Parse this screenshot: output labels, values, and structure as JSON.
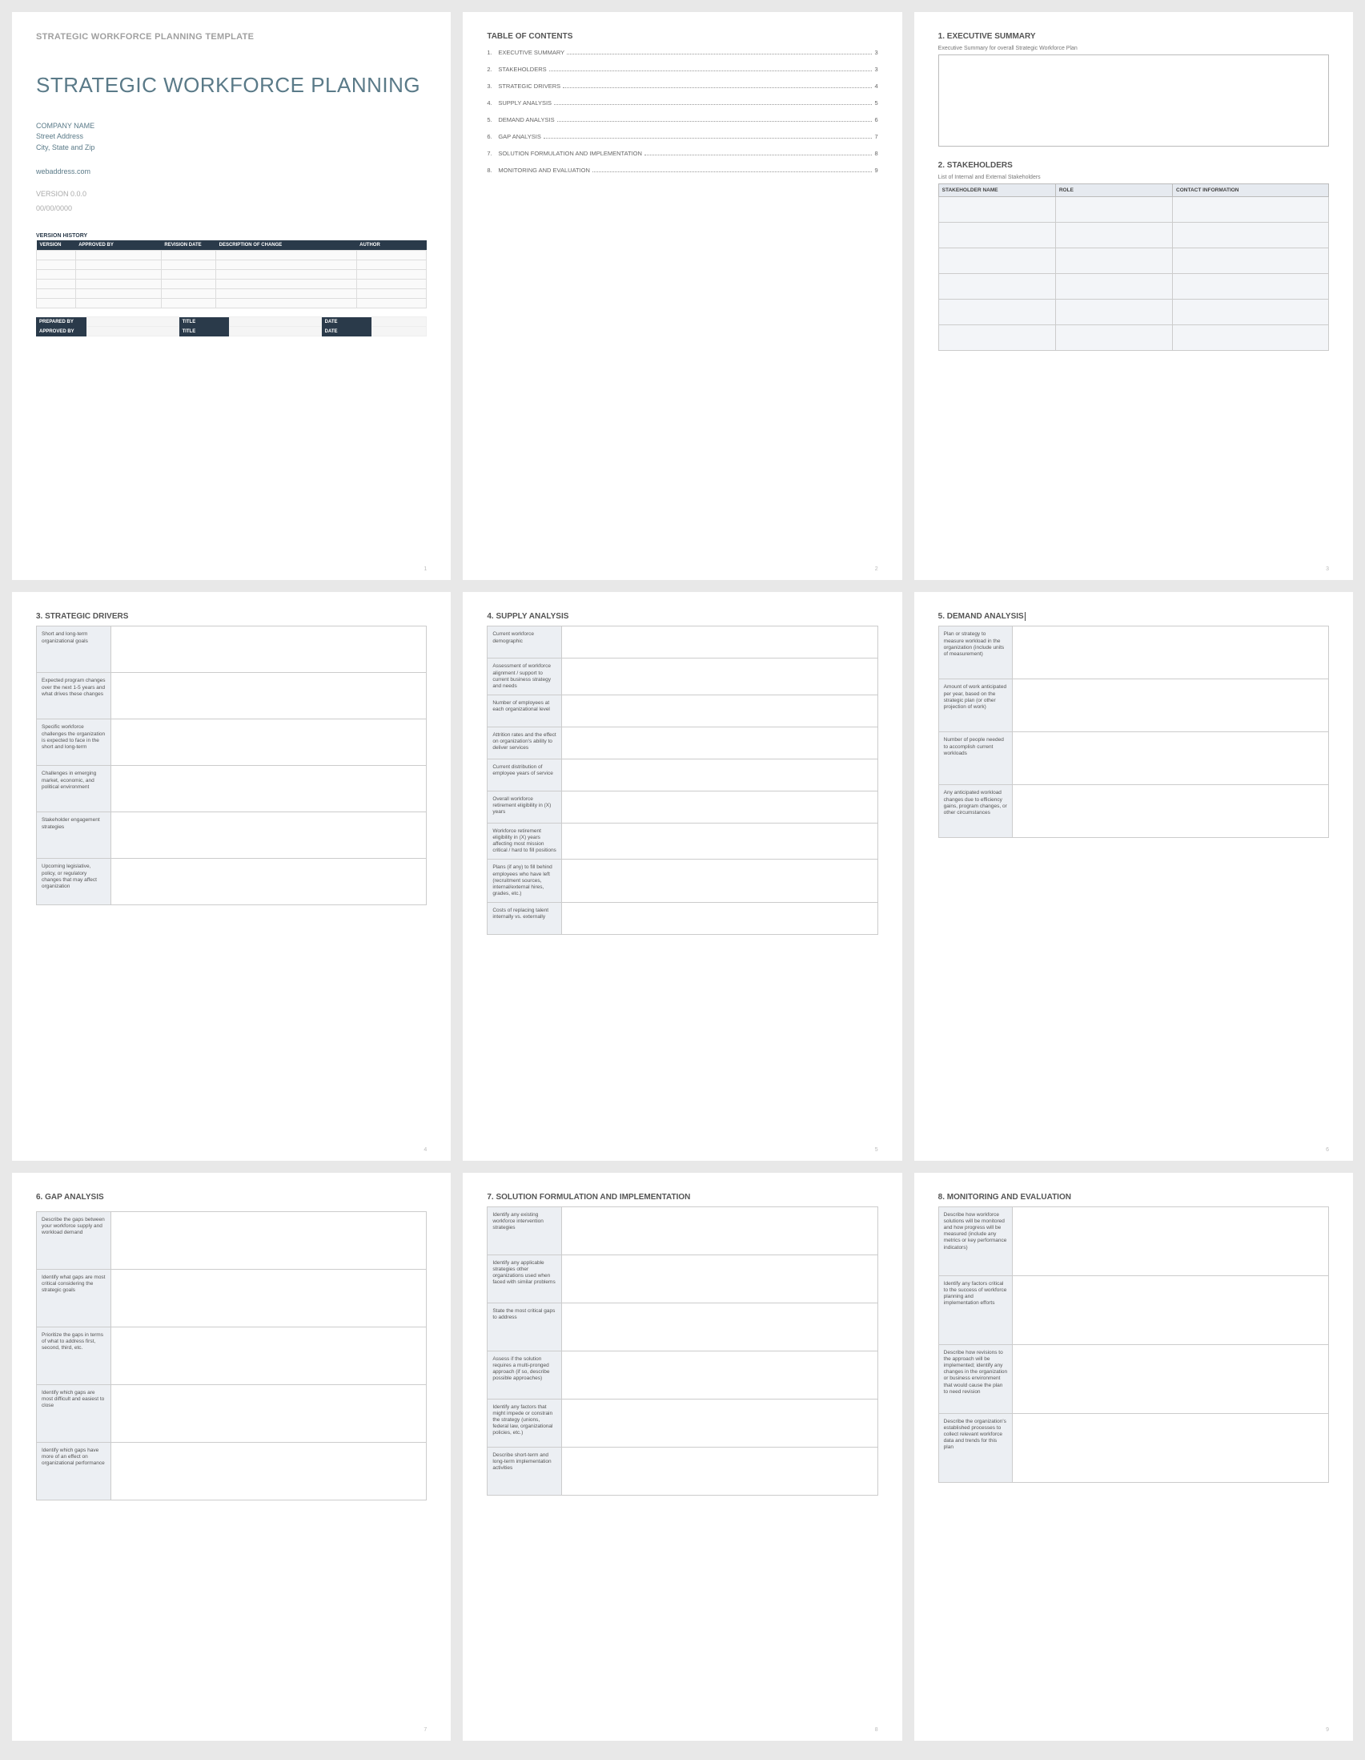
{
  "doc_header": "STRATEGIC WORKFORCE PLANNING TEMPLATE",
  "doc_title": "STRATEGIC WORKFORCE PLANNING",
  "company": {
    "name": "COMPANY NAME",
    "street": "Street Address",
    "city": "City, State and Zip",
    "web": "webaddress.com"
  },
  "version_line": "VERSION 0.0.0",
  "date_line": "00/00/0000",
  "version_history_title": "VERSION HISTORY",
  "vh_headers": [
    "VERSION",
    "APPROVED BY",
    "REVISION DATE",
    "DESCRIPTION OF CHANGE",
    "AUTHOR"
  ],
  "meta_labels": {
    "prepared": "PREPARED BY",
    "approved": "APPROVED BY",
    "title": "TITLE",
    "date": "DATE"
  },
  "toc_title": "TABLE OF CONTENTS",
  "toc": [
    {
      "n": "1.",
      "t": "EXECUTIVE SUMMARY",
      "p": "3"
    },
    {
      "n": "2.",
      "t": "STAKEHOLDERS",
      "p": "3"
    },
    {
      "n": "3.",
      "t": "STRATEGIC DRIVERS",
      "p": "4"
    },
    {
      "n": "4.",
      "t": "SUPPLY ANALYSIS",
      "p": "5"
    },
    {
      "n": "5.",
      "t": "DEMAND ANALYSIS",
      "p": "6"
    },
    {
      "n": "6.",
      "t": "GAP ANALYSIS",
      "p": "7"
    },
    {
      "n": "7.",
      "t": "SOLUTION FORMULATION AND IMPLEMENTATION",
      "p": "8"
    },
    {
      "n": "8.",
      "t": "MONITORING AND EVALUATION",
      "p": "9"
    }
  ],
  "exec": {
    "h": "1.  EXECUTIVE SUMMARY",
    "cap": "Executive Summary for overall Strategic Workforce Plan"
  },
  "stake": {
    "h": "2.  STAKEHOLDERS",
    "cap": "List of Internal and External Stakeholders",
    "cols": [
      "STAKEHOLDER NAME",
      "ROLE",
      "CONTACT INFORMATION"
    ]
  },
  "drivers": {
    "h": "3.  STRATEGIC DRIVERS",
    "rows": [
      "Short and long-term organizational goals",
      "Expected program changes over the next 1-5 years and what drives these changes",
      "Specific workforce challenges the organization is expected to face in the short and long-term",
      "Challenges in emerging market, economic, and political environment",
      "Stakeholder engagement strategies",
      "Upcoming legislative, policy, or regulatory changes that may affect organization"
    ]
  },
  "supply": {
    "h": "4.  SUPPLY ANALYSIS",
    "rows": [
      "Current workforce demographic",
      "Assessment of workforce alignment / support to current business strategy and needs",
      "Number of employees at each organizational level",
      "Attrition rates and the effect on organization's ability to deliver services",
      "Current distribution of employee years of service",
      "Overall workforce retirement eligibility in (X) years",
      "Workforce retirement eligibility in (X) years affecting most mission critical / hard to fill positions",
      "Plans (if any) to fill behind employees who have left (recruitment sources, internal/external hires, grades, etc.)",
      "Costs of replacing talent internally vs. externally"
    ]
  },
  "demand": {
    "h": "5.  DEMAND ANALYSIS",
    "rows": [
      "Plan or strategy to measure workload in the organization (include units of measurement)",
      "Amount of work anticipated per year, based on the strategic plan (or other projection of work)",
      "Number of people needed to accomplish current workloads",
      "Any anticipated workload changes due to efficiency gains, program changes, or other circumstances"
    ]
  },
  "gap": {
    "h": "6.  GAP ANALYSIS",
    "rows": [
      "Describe the gaps between your workforce supply and workload demand",
      "Identify what gaps are most critical considering the strategic goals",
      "Prioritize the gaps in terms of what to address first, second, third, etc.",
      "Identify which gaps are most difficult and easiest to close",
      "Identify which gaps have more of an effect on organizational performance"
    ]
  },
  "solution": {
    "h": "7.  SOLUTION FORMULATION AND IMPLEMENTATION",
    "rows": [
      "Identify any existing workforce intervention strategies",
      "Identify any applicable strategies other organizations used when faced with similar problems",
      "State the most critical gaps to address",
      "Assess if the solution requires a multi-pronged approach (if so, describe possible approaches)",
      "Identify any factors that might impede or constrain the strategy (unions, federal law, organizational policies, etc.)",
      "Describe short-term and long-term implementation activities"
    ]
  },
  "monitor": {
    "h": "8.  MONITORING AND EVALUATION",
    "rows": [
      "Describe how workforce solutions will be monitored and how progress will be measured (include any metrics or key performance indicators)",
      "Identify any factors critical to the success of workforce planning and implementation efforts",
      "Describe how revisions to the approach will be implemented; identify any changes in the organization or business environment that would cause the plan to need revision",
      "Describe the organization's established processes to collect relevant workforce data and trends for this plan"
    ]
  },
  "page_numbers": [
    "1",
    "2",
    "3",
    "4",
    "5",
    "6",
    "7",
    "8",
    "9"
  ]
}
